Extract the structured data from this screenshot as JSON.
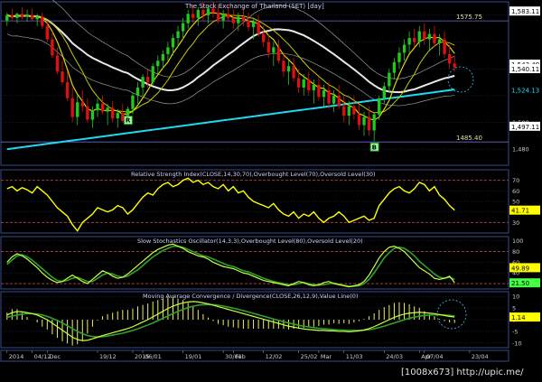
{
  "watermark": "[1008x673] http://upic.me/",
  "colors": {
    "background": "#000000",
    "grid": "#2a3a6a",
    "up_candle": "#22c822",
    "down_candle": "#e01010",
    "ma_short": "#d8d800",
    "ma_mid": "#e8e8e8",
    "ma_long": "#20d8f0",
    "bollinger": "#9a9a9a",
    "rsi_line": "#ffff00",
    "stoch_k": "#c8ff40",
    "macd_line": "#c8ff40",
    "macd_hist": "#f0f060",
    "level_line": "#c04040",
    "label_badge": "#ffffff",
    "badge_green": "#44ff44",
    "badge_yellow": "#ffff00"
  },
  "chart_data": [
    {
      "id": "price",
      "type": "candlestick",
      "title": "The Stock Exchange of Thailand (SET) [day]",
      "ylim": [
        1468,
        1590
      ],
      "y_ticks": [
        1480,
        1500,
        1520,
        1540,
        1560,
        1580
      ],
      "y_tick_labels": [
        "1,480",
        "1,500",
        "",
        "",
        "",
        ""
      ],
      "last_value_labels": [
        {
          "value": 1583.11,
          "text": "1,583.11",
          "color": "white"
        },
        {
          "value": 1543.49,
          "text": "1,543.49",
          "color": "white"
        },
        {
          "value": 1540.11,
          "text": "1,540.11",
          "color": "white"
        },
        {
          "value": 1524.13,
          "text": "1,524.13",
          "color": "cyan"
        },
        {
          "value": 1497.11,
          "text": "1,497.11",
          "color": "white"
        }
      ],
      "levels": [
        {
          "value": 1575.75,
          "text": "1575.75"
        },
        {
          "value": 1485.4,
          "text": "1485.40"
        }
      ],
      "markers": [
        {
          "type": "R",
          "index": 24,
          "value": 1506
        },
        {
          "type": "B",
          "index": 73,
          "value": 1486
        }
      ],
      "candles": [
        [
          1576,
          1582,
          1572,
          1580
        ],
        [
          1580,
          1585,
          1576,
          1578
        ],
        [
          1578,
          1582,
          1574,
          1581
        ],
        [
          1581,
          1586,
          1577,
          1579
        ],
        [
          1579,
          1584,
          1575,
          1580
        ],
        [
          1580,
          1585,
          1576,
          1577
        ],
        [
          1577,
          1581,
          1572,
          1579
        ],
        [
          1579,
          1582,
          1570,
          1572
        ],
        [
          1572,
          1576,
          1560,
          1562
        ],
        [
          1562,
          1568,
          1548,
          1550
        ],
        [
          1550,
          1556,
          1536,
          1538
        ],
        [
          1538,
          1546,
          1528,
          1530
        ],
        [
          1530,
          1538,
          1516,
          1518
        ],
        [
          1518,
          1526,
          1500,
          1504
        ],
        [
          1504,
          1520,
          1498,
          1515
        ],
        [
          1515,
          1524,
          1508,
          1512
        ],
        [
          1512,
          1518,
          1500,
          1502
        ],
        [
          1502,
          1512,
          1496,
          1509
        ],
        [
          1509,
          1518,
          1504,
          1514
        ],
        [
          1514,
          1520,
          1506,
          1508
        ],
        [
          1508,
          1514,
          1498,
          1511
        ],
        [
          1511,
          1516,
          1500,
          1503
        ],
        [
          1503,
          1510,
          1496,
          1507
        ],
        [
          1507,
          1514,
          1500,
          1501
        ],
        [
          1501,
          1512,
          1498,
          1510
        ],
        [
          1510,
          1522,
          1506,
          1520
        ],
        [
          1520,
          1530,
          1514,
          1526
        ],
        [
          1526,
          1536,
          1520,
          1534
        ],
        [
          1534,
          1540,
          1526,
          1530
        ],
        [
          1530,
          1544,
          1528,
          1542
        ],
        [
          1542,
          1550,
          1536,
          1546
        ],
        [
          1546,
          1554,
          1540,
          1551
        ],
        [
          1551,
          1560,
          1546,
          1556
        ],
        [
          1556,
          1566,
          1550,
          1563
        ],
        [
          1563,
          1572,
          1556,
          1568
        ],
        [
          1568,
          1578,
          1562,
          1574
        ],
        [
          1574,
          1584,
          1570,
          1581
        ],
        [
          1581,
          1588,
          1574,
          1578
        ],
        [
          1578,
          1586,
          1572,
          1584
        ],
        [
          1584,
          1590,
          1576,
          1580
        ],
        [
          1580,
          1588,
          1574,
          1585
        ],
        [
          1585,
          1590,
          1578,
          1582
        ],
        [
          1582,
          1588,
          1574,
          1576
        ],
        [
          1576,
          1584,
          1570,
          1581
        ],
        [
          1581,
          1587,
          1575,
          1578
        ],
        [
          1578,
          1584,
          1570,
          1574
        ],
        [
          1574,
          1582,
          1568,
          1579
        ],
        [
          1579,
          1585,
          1572,
          1576
        ],
        [
          1576,
          1582,
          1568,
          1571
        ],
        [
          1571,
          1578,
          1562,
          1575
        ],
        [
          1575,
          1580,
          1564,
          1566
        ],
        [
          1566,
          1572,
          1556,
          1560
        ],
        [
          1560,
          1566,
          1548,
          1552
        ],
        [
          1552,
          1560,
          1542,
          1556
        ],
        [
          1556,
          1562,
          1544,
          1546
        ],
        [
          1546,
          1552,
          1534,
          1538
        ],
        [
          1538,
          1546,
          1528,
          1542
        ],
        [
          1542,
          1548,
          1530,
          1533
        ],
        [
          1533,
          1540,
          1522,
          1526
        ],
        [
          1526,
          1536,
          1520,
          1532
        ],
        [
          1532,
          1538,
          1520,
          1524
        ],
        [
          1524,
          1532,
          1514,
          1528
        ],
        [
          1528,
          1534,
          1516,
          1519
        ],
        [
          1519,
          1528,
          1512,
          1524
        ],
        [
          1524,
          1530,
          1510,
          1514
        ],
        [
          1514,
          1524,
          1508,
          1520
        ],
        [
          1520,
          1528,
          1510,
          1512
        ],
        [
          1512,
          1520,
          1500,
          1505
        ],
        [
          1505,
          1516,
          1498,
          1512
        ],
        [
          1512,
          1520,
          1502,
          1506
        ],
        [
          1506,
          1514,
          1494,
          1498
        ],
        [
          1498,
          1508,
          1490,
          1504
        ],
        [
          1504,
          1512,
          1490,
          1494
        ],
        [
          1494,
          1508,
          1486,
          1506
        ],
        [
          1506,
          1520,
          1502,
          1518
        ],
        [
          1518,
          1530,
          1514,
          1527
        ],
        [
          1527,
          1540,
          1522,
          1537
        ],
        [
          1537,
          1548,
          1532,
          1545
        ],
        [
          1545,
          1556,
          1540,
          1552
        ],
        [
          1552,
          1562,
          1546,
          1558
        ],
        [
          1558,
          1568,
          1552,
          1563
        ],
        [
          1563,
          1570,
          1556,
          1560
        ],
        [
          1560,
          1572,
          1556,
          1568
        ],
        [
          1568,
          1574,
          1558,
          1562
        ],
        [
          1562,
          1570,
          1554,
          1566
        ],
        [
          1566,
          1572,
          1556,
          1559
        ],
        [
          1559,
          1566,
          1550,
          1562
        ],
        [
          1562,
          1568,
          1548,
          1551
        ],
        [
          1551,
          1558,
          1540,
          1544
        ],
        [
          1544,
          1550,
          1538,
          1541
        ]
      ]
    },
    {
      "id": "rsi",
      "type": "line",
      "title": "Relative Strength Index(CLOSE,14,30,70),Overbought Level(70),Oversold Level(30)",
      "ylim": [
        20,
        80
      ],
      "y_ticks": [
        30,
        40,
        50,
        60,
        70
      ],
      "y_tick_labels": [
        "30",
        "40",
        "50",
        "60",
        "70"
      ],
      "levels": [
        30,
        70
      ],
      "last_value": {
        "value": 41.71,
        "text": "41.71"
      },
      "values": [
        62,
        64,
        60,
        63,
        61,
        58,
        64,
        60,
        56,
        50,
        44,
        40,
        36,
        28,
        22,
        30,
        34,
        38,
        44,
        42,
        40,
        42,
        46,
        44,
        38,
        42,
        48,
        54,
        58,
        56,
        62,
        66,
        68,
        64,
        66,
        70,
        72,
        68,
        70,
        66,
        68,
        64,
        62,
        66,
        60,
        64,
        58,
        60,
        54,
        50,
        48,
        46,
        44,
        48,
        42,
        38,
        36,
        40,
        34,
        38,
        36,
        40,
        34,
        30,
        34,
        36,
        40,
        36,
        30,
        32,
        34,
        36,
        32,
        34,
        46,
        52,
        58,
        62,
        64,
        60,
        58,
        62,
        68,
        66,
        60,
        64,
        56,
        52,
        46,
        41.71
      ]
    },
    {
      "id": "stoch",
      "type": "line",
      "title": "Slow Stochastics Oscillator(14,3,3),Overbought Level(80),Oversold Level(20)",
      "ylim": [
        10,
        108
      ],
      "y_ticks": [
        20,
        40,
        60,
        80,
        100
      ],
      "y_tick_labels": [
        "20",
        "40",
        "60",
        "80",
        "100"
      ],
      "levels": [
        20,
        80
      ],
      "last_values": [
        {
          "value": 49.89,
          "text": "49.89",
          "color": "yellow"
        },
        {
          "value": 21.5,
          "text": "21.50",
          "color": "green"
        }
      ],
      "series": [
        {
          "values": [
            60,
            70,
            76,
            72,
            66,
            58,
            50,
            40,
            32,
            26,
            22,
            24,
            30,
            36,
            30,
            24,
            20,
            28,
            36,
            44,
            40,
            34,
            30,
            32,
            38,
            46,
            54,
            62,
            70,
            78,
            84,
            88,
            92,
            94,
            90,
            86,
            80,
            76,
            72,
            70,
            66,
            60,
            56,
            52,
            50,
            48,
            44,
            40,
            38,
            34,
            30,
            26,
            24,
            22,
            20,
            18,
            16,
            20,
            24,
            22,
            18,
            16,
            18,
            22,
            24,
            20,
            18,
            16,
            14,
            16,
            18,
            24,
            36,
            52,
            68,
            80,
            88,
            90,
            86,
            80,
            70,
            60,
            50,
            44,
            38,
            30,
            28,
            30,
            34,
            22
          ]
        },
        {
          "values": [
            56,
            64,
            72,
            74,
            70,
            64,
            56,
            48,
            40,
            32,
            26,
            24,
            26,
            30,
            32,
            28,
            24,
            24,
            30,
            36,
            40,
            38,
            34,
            32,
            34,
            40,
            46,
            54,
            62,
            70,
            76,
            82,
            86,
            90,
            90,
            88,
            84,
            80,
            76,
            72,
            70,
            66,
            62,
            58,
            54,
            52,
            48,
            44,
            42,
            38,
            34,
            30,
            27,
            24,
            22,
            20,
            18,
            18,
            20,
            22,
            20,
            18,
            17,
            18,
            20,
            21,
            19,
            17,
            15,
            15,
            16,
            20,
            28,
            40,
            54,
            68,
            78,
            86,
            88,
            86,
            80,
            72,
            62,
            54,
            46,
            38,
            32,
            30,
            32,
            28
          ]
        }
      ]
    },
    {
      "id": "macd",
      "type": "line",
      "title": "Moving Average Convergence / Divergence(CLOSE,26,12,9),Value Line(0)",
      "ylim": [
        -12,
        12
      ],
      "y_ticks": [
        -10,
        -5,
        0,
        5,
        10
      ],
      "y_tick_labels": [
        "-10",
        "-5",
        "0",
        "5",
        "10"
      ],
      "last_value": {
        "value": 1.14,
        "text": "1.14"
      },
      "series": [
        {
          "values": [
            2,
            3,
            3.5,
            3.4,
            3,
            2.6,
            2,
            1,
            0,
            -1.5,
            -3,
            -4.5,
            -6,
            -7.5,
            -8.5,
            -9,
            -8.8,
            -8.2,
            -7.5,
            -6.8,
            -6.2,
            -5.6,
            -5,
            -4.4,
            -3.8,
            -3,
            -2,
            -1,
            0,
            1.2,
            2.4,
            3.6,
            4.8,
            5.8,
            6.6,
            7.2,
            7.6,
            7.8,
            7.6,
            7.2,
            6.8,
            6.2,
            5.6,
            5,
            4.4,
            3.8,
            3.2,
            2.6,
            2,
            1.4,
            0.8,
            0.2,
            -0.4,
            -1,
            -1.6,
            -2.2,
            -2.8,
            -3.2,
            -3.6,
            -4,
            -4.2,
            -4.4,
            -4.6,
            -4.6,
            -4.8,
            -4.8,
            -5,
            -5,
            -5.2,
            -5,
            -4.8,
            -4.4,
            -3.8,
            -3,
            -2,
            -1,
            0,
            1,
            1.8,
            2.4,
            2.8,
            3,
            3.2,
            3,
            2.8,
            2.6,
            2.2,
            1.8,
            1.4,
            1.14
          ]
        },
        {
          "values": [
            1,
            1.5,
            2,
            2.4,
            2.6,
            2.6,
            2.4,
            2,
            1.4,
            0.6,
            -0.4,
            -1.4,
            -2.6,
            -3.8,
            -5,
            -6,
            -6.8,
            -7.2,
            -7.4,
            -7.3,
            -7,
            -6.6,
            -6.2,
            -5.8,
            -5.2,
            -4.6,
            -3.9,
            -3.1,
            -2.3,
            -1.4,
            -0.4,
            0.6,
            1.6,
            2.6,
            3.6,
            4.4,
            5.2,
            5.8,
            6.2,
            6.4,
            6.5,
            6.4,
            6.2,
            5.8,
            5.4,
            4.9,
            4.4,
            3.9,
            3.3,
            2.7,
            2.1,
            1.5,
            0.9,
            0.3,
            -0.3,
            -0.9,
            -1.4,
            -1.9,
            -2.4,
            -2.8,
            -3.1,
            -3.4,
            -3.7,
            -3.9,
            -4.1,
            -4.3,
            -4.4,
            -4.5,
            -4.6,
            -4.6,
            -4.6,
            -4.5,
            -4.3,
            -3.9,
            -3.4,
            -2.8,
            -2.1,
            -1.4,
            -0.7,
            0,
            0.6,
            1.1,
            1.5,
            1.8,
            2,
            2.1,
            2.1,
            2,
            1.8,
            1.6
          ]
        }
      ]
    }
  ],
  "x_axis": {
    "labels": [
      {
        "text": "2014",
        "x": 0
      },
      {
        "text": "04/12",
        "x": 5
      },
      {
        "text": "Dec",
        "x": 8
      },
      {
        "text": "19/12",
        "x": 18
      },
      {
        "text": "2015",
        "x": 25
      },
      {
        "text": "06/01",
        "x": 27
      },
      {
        "text": "19/01",
        "x": 35
      },
      {
        "text": "30/01",
        "x": 43
      },
      {
        "text": "Feb",
        "x": 45
      },
      {
        "text": "12/02",
        "x": 51
      },
      {
        "text": "25/02",
        "x": 58
      },
      {
        "text": "Mar",
        "x": 62
      },
      {
        "text": "11/03",
        "x": 67
      },
      {
        "text": "24/03",
        "x": 75
      },
      {
        "text": "Apr",
        "x": 82
      },
      {
        "text": "07/04",
        "x": 83
      },
      {
        "text": "23/04",
        "x": 92
      }
    ]
  }
}
